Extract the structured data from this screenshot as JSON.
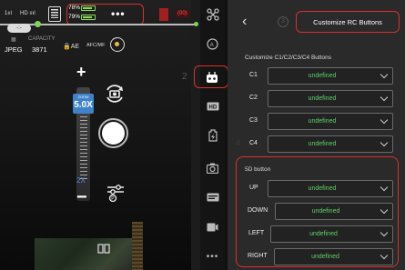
{
  "status": {
    "signal1": "1ııl",
    "signal2": "HD ıııl",
    "battery_top": "78%",
    "battery_bottom": "79%",
    "more": "•••",
    "record_time": "(00)",
    "lens_pill": "-:-"
  },
  "camera_info": {
    "capacity_label": "CAPACITY",
    "format": "JPEG",
    "capacity": "3871",
    "ae": "AE",
    "af": "AFC/MF"
  },
  "zoom": {
    "plus": "+",
    "badge_top": "ZOOM",
    "badge_value": "5.0X",
    "mark_2x": "2X",
    "minus": "−"
  },
  "toolbar": {
    "step_number": "2"
  },
  "panel": {
    "back": "‹",
    "step_number": "3",
    "title": "Customize RC Buttons",
    "c_section": "Customize C1/C2/C3/C4 Buttons",
    "c_rows": [
      {
        "label": "C1",
        "value": "undefined"
      },
      {
        "label": "C2",
        "value": "undefined"
      },
      {
        "label": "C3",
        "value": "undefined"
      },
      {
        "label": "C4",
        "value": "undefined"
      }
    ],
    "sd_section": "5D button",
    "sd_rows": [
      {
        "label": "UP",
        "value": "undefined"
      },
      {
        "label": "DOWN",
        "value": "undefined"
      },
      {
        "label": "LEFT",
        "value": "undefined"
      },
      {
        "label": "RIGHT",
        "value": "undefined"
      }
    ],
    "faint_number": "4"
  },
  "colors": {
    "highlight": "#d9302c",
    "value_green": "#5ed16a",
    "zoom_blue": "#3f82c7"
  }
}
